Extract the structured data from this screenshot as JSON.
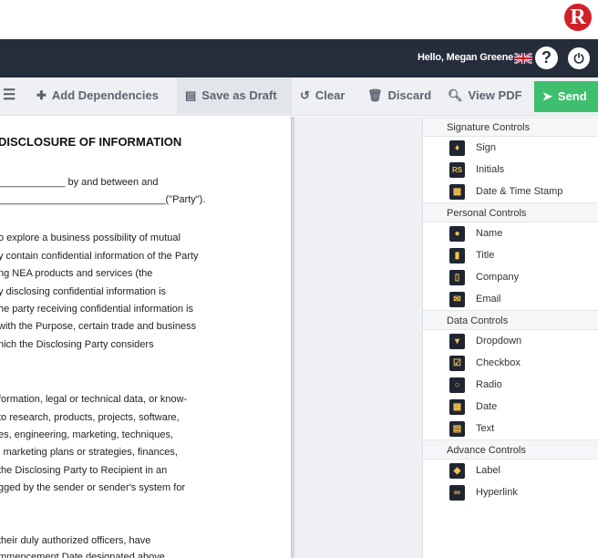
{
  "header": {
    "logo_letter": "R",
    "greeting": "Hello, Megan Greene",
    "help_icon": "question-icon",
    "power_icon": "power-icon"
  },
  "toolbar": {
    "menu_icon": "menu-icon",
    "add_dependencies": "Add Dependencies",
    "save_as_draft": "Save as Draft",
    "clear": "Clear",
    "discard": "Discard",
    "view_pdf": "View PDF",
    "send": "Send"
  },
  "document": {
    "title": "DISCLOSURE OF INFORMATION",
    "lines": [
      "____________ by and between and",
      "______________________________(\"Party\").",
      "o explore a business possibility of mutual",
      "y contain confidential information of the Party",
      "ng NEA products and services (the",
      "y disclosing confidential information is",
      "he party receiving confidential information is",
      "with the Purpose, certain trade and business",
      "hich the Disclosing Party considers",
      "formation, legal or technical data, or know-",
      "to research, products, projects, software,",
      "es, engineering, marketing, techniques,",
      "l marketing plans or strategies, finances,",
      "the Disclosing Party to Recipient in an",
      "gged by the sender or sender's system for",
      " their duly authorized officers, have",
      "mmencement Date designated above"
    ]
  },
  "panel": {
    "sections": [
      {
        "title": "Signature Controls",
        "items": [
          {
            "label": "Sign",
            "icon": "pen-nib-icon"
          },
          {
            "label": "Initials",
            "icon": "initials-icon"
          },
          {
            "label": "Date & Time Stamp",
            "icon": "calendar-clock-icon"
          }
        ]
      },
      {
        "title": "Personal Controls",
        "items": [
          {
            "label": "Name",
            "icon": "user-icon"
          },
          {
            "label": "Title",
            "icon": "id-card-icon"
          },
          {
            "label": "Company",
            "icon": "building-icon"
          },
          {
            "label": "Email",
            "icon": "envelope-icon"
          }
        ]
      },
      {
        "title": "Data Controls",
        "items": [
          {
            "label": "Dropdown",
            "icon": "caret-down-icon"
          },
          {
            "label": "Checkbox",
            "icon": "checkbox-icon"
          },
          {
            "label": "Radio",
            "icon": "radio-icon"
          },
          {
            "label": "Date",
            "icon": "calendar-icon"
          },
          {
            "label": "Text",
            "icon": "text-file-icon"
          }
        ]
      },
      {
        "title": "Advance Controls",
        "items": [
          {
            "label": "Label",
            "icon": "tag-icon"
          },
          {
            "label": "Hyperlink",
            "icon": "link-icon"
          }
        ]
      }
    ]
  },
  "colors": {
    "navbar": "#252d3a",
    "send": "#3ec06e",
    "logo": "#cf2127",
    "icon_accent": "#f4c14d"
  }
}
